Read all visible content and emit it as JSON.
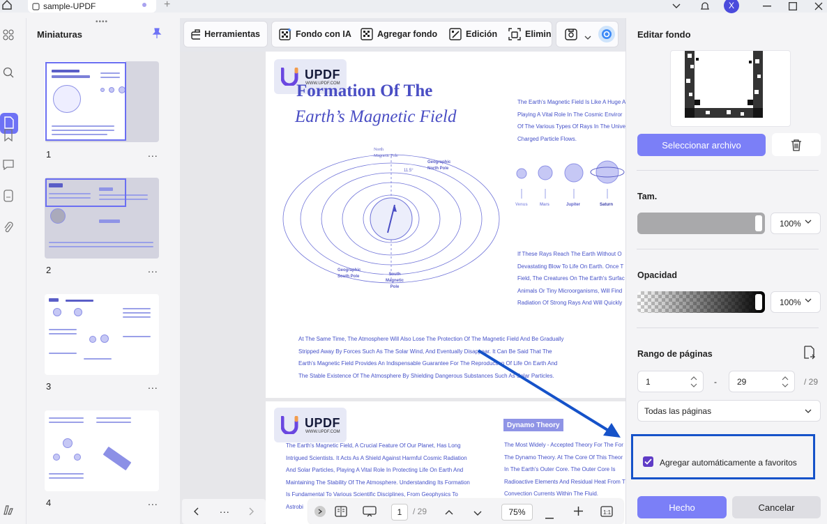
{
  "titlebar": {
    "tab_title": "sample-UPDF",
    "avatar_letter": "X"
  },
  "thumbnails": {
    "title": "Miniaturas",
    "pages": [
      "1",
      "2",
      "3",
      "4"
    ],
    "more_label": "..."
  },
  "toolbar": {
    "tools_label": "Herramientas",
    "ai_bg_label": "Fondo con IA",
    "add_bg_label": "Agregar fondo",
    "edit_label": "Edición",
    "delete_label": "Elimin"
  },
  "document": {
    "page1": {
      "logo": "UPDF",
      "logo_url": "WWW.UPDF.COM",
      "title_line1": "Formation Of The",
      "title_line2": "Earth’s Magnetic Field",
      "diagram_labels": {
        "north": "North\nMagnetic Pole",
        "geo_north": "Geographic\nNorth Pole",
        "geo_south": "Geographic\nSouth Pole",
        "south": "South\nMagnetic\nPole",
        "angle": "11.5°"
      },
      "planets": [
        "Venus",
        "Mars",
        "Jupiter",
        "Saturn"
      ],
      "right_text_1": [
        "The Earth's Magnetic Field Is Like A Huge A",
        "Playing A Vital Role In The Cosmic Enviror",
        "Of The Various Types Of Rays In The Unive",
        "Charged Particle Flows."
      ],
      "right_text_2": [
        "If These Rays Reach The Earth Without O",
        "Devastating Blow To Life On Earth. Once T",
        "Field, The Creatures On The Earth's Surfac",
        "Animals Or Tiny Microorganisms, Will Find",
        "Radiation Of Strong Rays And Will Quickly"
      ],
      "bottom_text": [
        "At The Same Time, The Atmosphere Will Also Lose The Protection Of The Magnetic Field And Be Gradually",
        "Stripped Away By Forces Such As The Solar Wind, And Eventually Disappear. It Can Be Said That The",
        "Earth's Magnetic Field Provides An Indispensable Guarantee For The Reproduction Of Life On Earth And",
        "The Stable Existence Of The Atmosphere By Shielding Dangerous Substances Such As Solar Particles."
      ]
    },
    "page2": {
      "logo": "UPDF",
      "logo_url": "WWW.UPDF.COM",
      "badge": "Dynamo Theory",
      "left_text": [
        "The Earth's Magnetic Field, A Crucial Feature Of Our Planet, Has Long",
        "Intrigued Scientists. It Acts As A Shield Against Harmful Cosmic Radiation",
        "And Solar Particles, Playing A Vital Role In Protecting Life On Earth And",
        "Maintaining The Stability Of The Atmosphere. Understanding Its Formation",
        "Is Fundamental To Various Scientific Disciplines, From Geophysics To",
        "Astrobi"
      ],
      "right_text": [
        "The Most Widely - Accepted Theory For The For",
        "The Dynamo Theory. At The Core Of This Theor",
        "In The Earth's Outer Core. The Outer Core Is",
        "Radioactive Elements And Residual Heat From T",
        "Convection Currents Within The Fluid."
      ]
    }
  },
  "bottombar": {
    "current_page": "1",
    "total_pages": "/ 29",
    "zoom": "75%"
  },
  "panel": {
    "title": "Editar fondo",
    "select_file_label": "Seleccionar archivo",
    "size_label": "Tam.",
    "size_value": "100%",
    "opacity_label": "Opacidad",
    "opacity_value": "100%",
    "range_label": "Rango de páginas",
    "range_from": "1",
    "range_dash": "-",
    "range_to": "29",
    "range_total": "/ 29",
    "pages_option": "Todas las páginas",
    "favorites_label": "Agregar automáticamente a favoritos",
    "favorites_checked": true,
    "done_label": "Hecho",
    "cancel_label": "Cancelar"
  },
  "colors": {
    "accent": "#7b7ff7",
    "doc_text": "#4450c8",
    "annotation": "#1552c9"
  }
}
